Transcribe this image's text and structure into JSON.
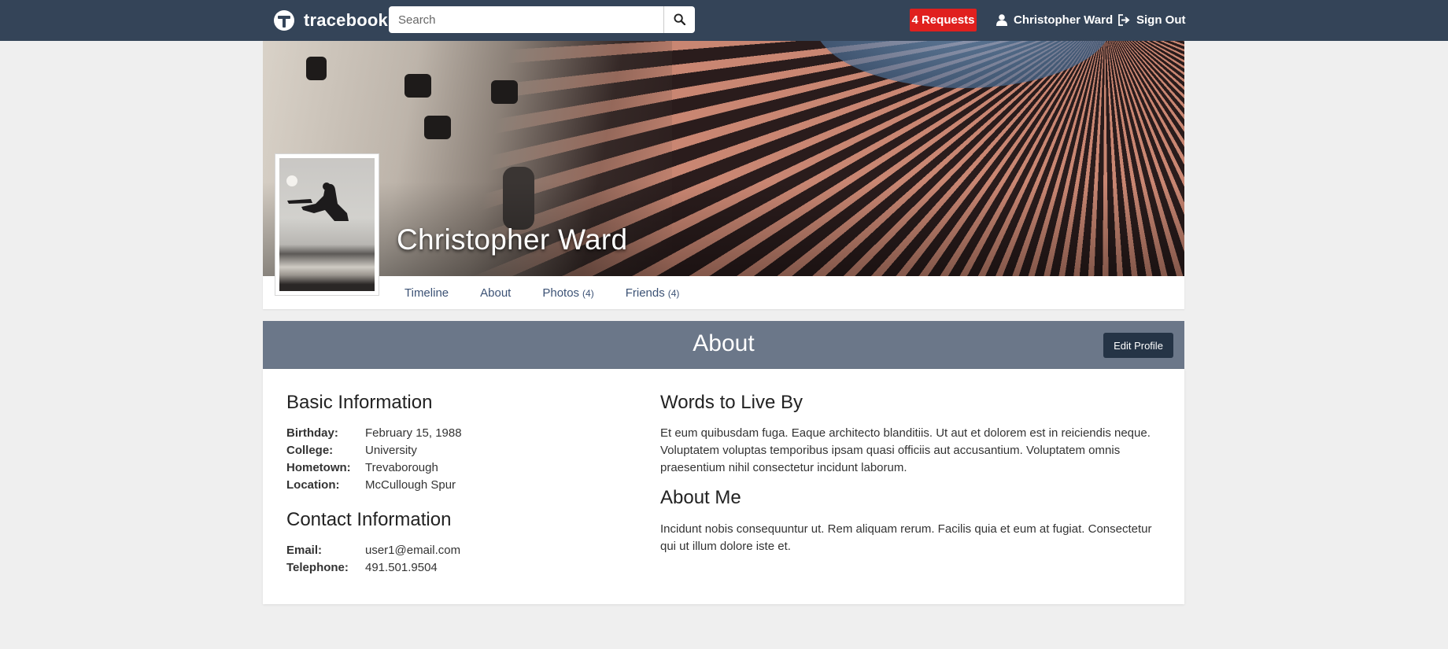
{
  "navbar": {
    "brand": "tracebook",
    "search_placeholder": "Search",
    "requests": "4 Requests",
    "user": "Christopher Ward",
    "signout": "Sign Out"
  },
  "profile": {
    "name": "Christopher Ward",
    "tabs": [
      {
        "label": "Timeline",
        "count": ""
      },
      {
        "label": "About",
        "count": ""
      },
      {
        "label": "Photos",
        "count": "(4)"
      },
      {
        "label": "Friends",
        "count": "(4)"
      }
    ]
  },
  "about": {
    "title": "About",
    "edit_label": "Edit Profile",
    "basic": {
      "heading": "Basic Information",
      "rows": [
        {
          "label": "Birthday:",
          "value": "February 15, 1988"
        },
        {
          "label": "College:",
          "value": "University"
        },
        {
          "label": "Hometown:",
          "value": "Trevaborough"
        },
        {
          "label": "Location:",
          "value": "McCullough Spur"
        }
      ]
    },
    "contact": {
      "heading": "Contact Information",
      "rows": [
        {
          "label": "Email:",
          "value": "user1@email.com"
        },
        {
          "label": "Telephone:",
          "value": "491.501.9504"
        }
      ]
    },
    "words": {
      "heading": "Words to Live By",
      "text": "Et eum quibusdam fuga. Eaque architecto blanditiis. Ut aut et dolorem est in reiciendis neque. Voluptatem voluptas temporibus ipsam quasi officiis aut accusantium. Voluptatem omnis praesentium nihil consectetur incidunt laborum."
    },
    "me": {
      "heading": "About Me",
      "text": "Incidunt nobis consequuntur ut. Rem aliquam rerum. Facilis quia et eum at fugiat. Consectetur qui ut illum dolore iste et."
    }
  },
  "icons": {
    "logo": "tracebook-logo-icon",
    "search": "search-icon",
    "user": "user-icon",
    "signout": "sign-out-icon"
  },
  "colors": {
    "navbar": "#344458",
    "requests_badge": "#e0201e",
    "about_header": "#6b7789",
    "edit_button": "#253446",
    "tab_link": "#3c5275"
  }
}
